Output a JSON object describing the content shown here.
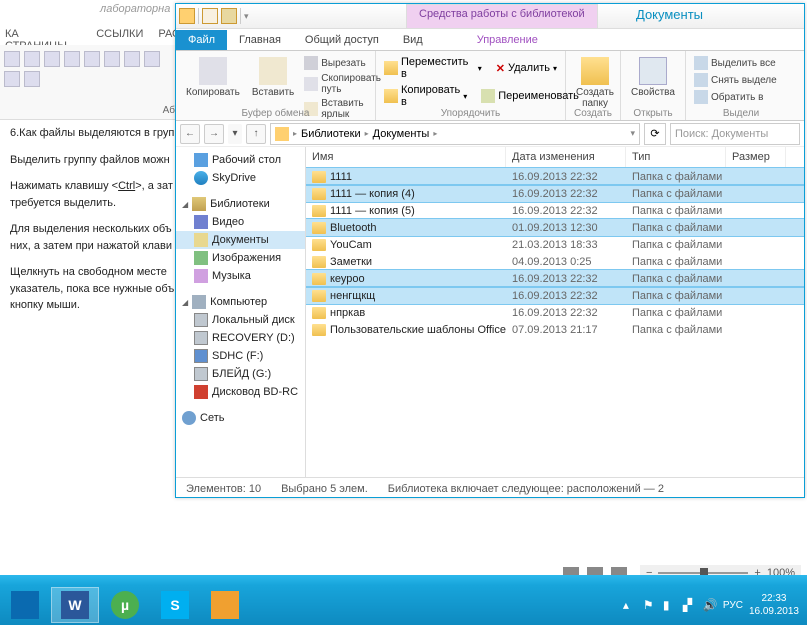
{
  "word": {
    "title": "лабораторна",
    "tabs": [
      "КА СТРАНИЦЫ",
      "ССЫЛКИ",
      "РАС"
    ],
    "group_label": "Аб",
    "doc_lines": {
      "q6": "6.Как файлы выделяются в груп",
      "p1": "Выделить группу файлов можн",
      "p2a": "Нажимать клавишу <",
      "p2key": "Ctrl",
      "p2b": ">, а зат",
      "p2c": "требуется выделить.",
      "p3a": "Для выделения нескольких объ",
      "p3b": "них, а затем при нажатой клави",
      "p4a": "Щелкнуть на свободном месте",
      "p4b": "указатель, пока все нужные объ",
      "p4c": "кнопку мыши."
    }
  },
  "explorer": {
    "context_tab": "Средства работы с библиотекой",
    "window_title": "Документы",
    "tabs": {
      "file": "Файл",
      "home": "Главная",
      "share": "Общий доступ",
      "view": "Вид",
      "manage": "Управление"
    },
    "ribbon": {
      "clipboard": {
        "copy": "Копировать",
        "paste": "Вставить",
        "cut": "Вырезать",
        "copy_path": "Скопировать путь",
        "paste_shortcut": "Вставить ярлык",
        "label": "Буфер обмена"
      },
      "organize": {
        "move": "Переместить в",
        "copy_to": "Копировать в",
        "delete": "Удалить",
        "rename": "Переименовать",
        "label": "Упорядочить"
      },
      "new": {
        "folder": "Создать папку",
        "label": "Создать"
      },
      "open": {
        "props": "Свойства",
        "label": "Открыть"
      },
      "select": {
        "all": "Выделить все",
        "none": "Снять выделе",
        "invert": "Обратить в",
        "label": "Выдели"
      }
    },
    "breadcrumb": {
      "lib": "Библиотеки",
      "doc": "Документы"
    },
    "search_placeholder": "Поиск: Документы",
    "nav": {
      "desktop": "Рабочий стол",
      "skydrive": "SkyDrive",
      "libraries": "Библиотеки",
      "video": "Видео",
      "documents": "Документы",
      "images": "Изображения",
      "music": "Музыка",
      "computer": "Компьютер",
      "local": "Локальный диск",
      "recovery": "RECOVERY (D:)",
      "sdhc": "SDHC (F:)",
      "blade": "БЛЕЙД (G:)",
      "bd": "Дисковод BD-RС",
      "network": "Сеть"
    },
    "columns": {
      "name": "Имя",
      "date": "Дата изменения",
      "type": "Тип",
      "size": "Размер"
    },
    "files": [
      {
        "name": "1111",
        "date": "16.09.2013 22:32",
        "type": "Папка с файлами",
        "selected": true
      },
      {
        "name": "1111 — копия (4)",
        "date": "16.09.2013 22:32",
        "type": "Папка с файлами",
        "selected": true
      },
      {
        "name": "1111 — копия (5)",
        "date": "16.09.2013 22:32",
        "type": "Папка с файлами",
        "selected": false
      },
      {
        "name": "Bluetooth",
        "date": "01.09.2013 12:30",
        "type": "Папка с файлами",
        "selected": true
      },
      {
        "name": "YouCam",
        "date": "21.03.2013 18:33",
        "type": "Папка с файлами",
        "selected": false
      },
      {
        "name": "Заметки",
        "date": "04.09.2013 0:25",
        "type": "Папка с файлами",
        "selected": false
      },
      {
        "name": "кеуроо",
        "date": "16.09.2013 22:32",
        "type": "Папка с файлами",
        "selected": true
      },
      {
        "name": "ненгщкщ",
        "date": "16.09.2013 22:32",
        "type": "Папка с файлами",
        "selected": true
      },
      {
        "name": "нпркав",
        "date": "16.09.2013 22:32",
        "type": "Папка с файлами",
        "selected": false
      },
      {
        "name": "Пользовательские шаблоны Office",
        "date": "07.09.2013 21:17",
        "type": "Папка с файлами",
        "selected": false
      }
    ],
    "status": {
      "count": "Элементов: 10",
      "selected": "Выбрано 5 элем.",
      "lib_info": "Библиотека включает следующее: расположений — 2"
    }
  },
  "taskbar": {
    "zoom": "100%",
    "lang": "РУС",
    "time": "22:33",
    "date": "16.09.2013"
  }
}
